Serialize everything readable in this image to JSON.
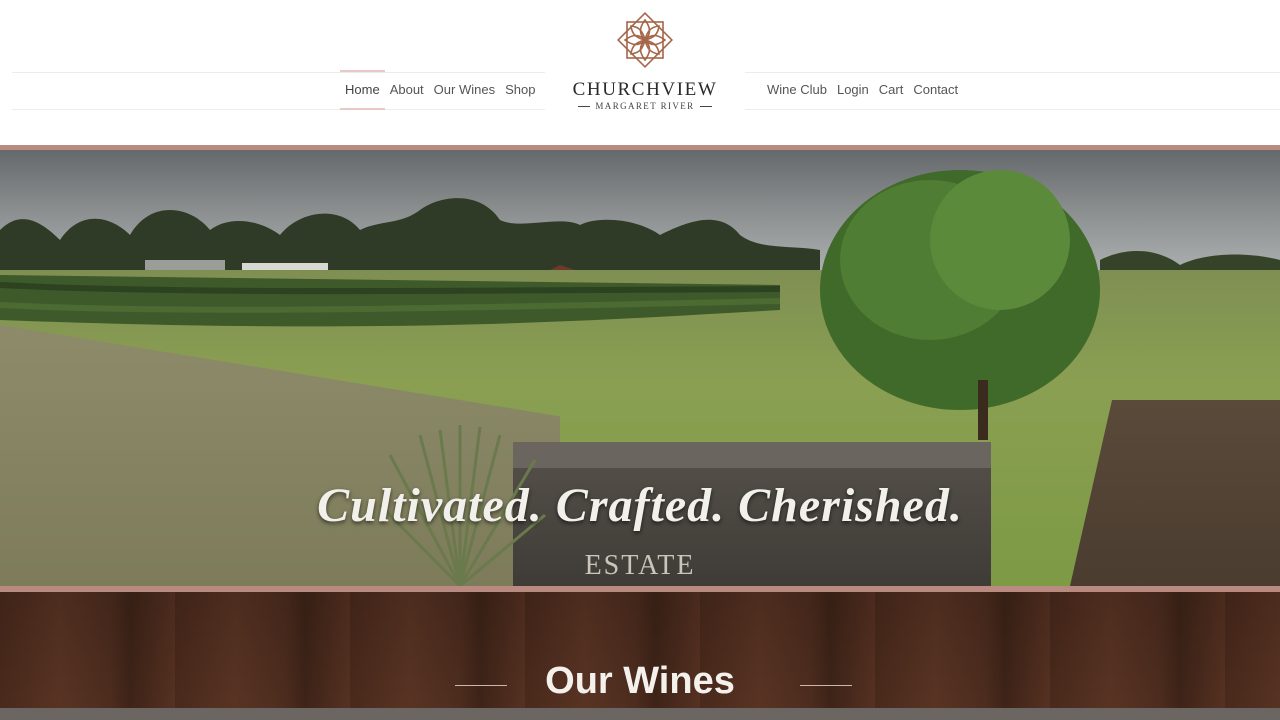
{
  "nav": {
    "left": [
      "Home",
      "About",
      "Our Wines",
      "Shop"
    ],
    "right": [
      "Wine Club",
      "Login",
      "Cart",
      "Contact"
    ],
    "active": "Home"
  },
  "logo": {
    "name": "CHURCHVIEW",
    "subtitle": "MARGARET RIVER",
    "icon": "flower-rosette-icon",
    "color": "#a5664a"
  },
  "hero": {
    "tagline": "Cultivated. Crafted. Cherished.",
    "sign_text": "ESTATE"
  },
  "section": {
    "title": "Our Wines"
  },
  "colors": {
    "accent_border": "#b98a7f",
    "nav_active": "#e8c9c4",
    "wood": "#4a2a1c"
  }
}
